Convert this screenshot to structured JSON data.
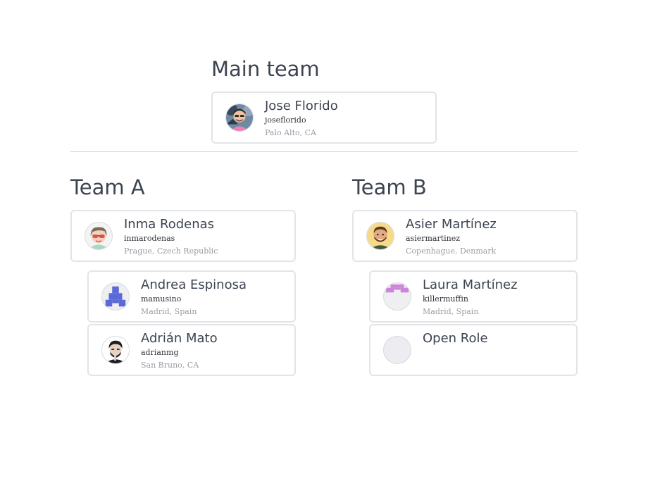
{
  "main_team": {
    "title": "Main team",
    "lead": {
      "name": "Jose Florido",
      "handle": "joseflorido",
      "location": "Palo Alto, CA",
      "avatar_icon": "person-avatar-icon"
    }
  },
  "team_a": {
    "title": "Team A",
    "lead": {
      "name": "Inma Rodenas",
      "handle": "inmarodenas",
      "location": "Prague, Czech Republic",
      "avatar_icon": "person-avatar-icon"
    },
    "members": [
      {
        "name": "Andrea Espinosa",
        "handle": "mamusino",
        "location": "Madrid, Spain",
        "avatar_icon": "identicon-avatar-icon"
      },
      {
        "name": "Adrián Mato",
        "handle": "adrianmg",
        "location": "San Bruno, CA",
        "avatar_icon": "person-avatar-icon"
      }
    ]
  },
  "team_b": {
    "title": "Team B",
    "lead": {
      "name": "Asier Martínez",
      "handle": "asiermartinez",
      "location": "Copenhague, Denmark",
      "avatar_icon": "person-avatar-icon"
    },
    "members": [
      {
        "name": "Laura Martínez",
        "handle": "killermuffin",
        "location": "Madrid, Spain",
        "avatar_icon": "identicon-avatar-icon"
      },
      {
        "name": "Open Role",
        "avatar_icon": "empty-avatar-icon"
      }
    ]
  },
  "colors": {
    "text": "#3c4451",
    "muted": "#9a9ca3",
    "border": "#e3e4e8",
    "divider": "#cfd1d6",
    "identicon_blue": "#5b6ad6",
    "identicon_purple": "#cc85db",
    "empty_avatar": "#ececf1"
  }
}
